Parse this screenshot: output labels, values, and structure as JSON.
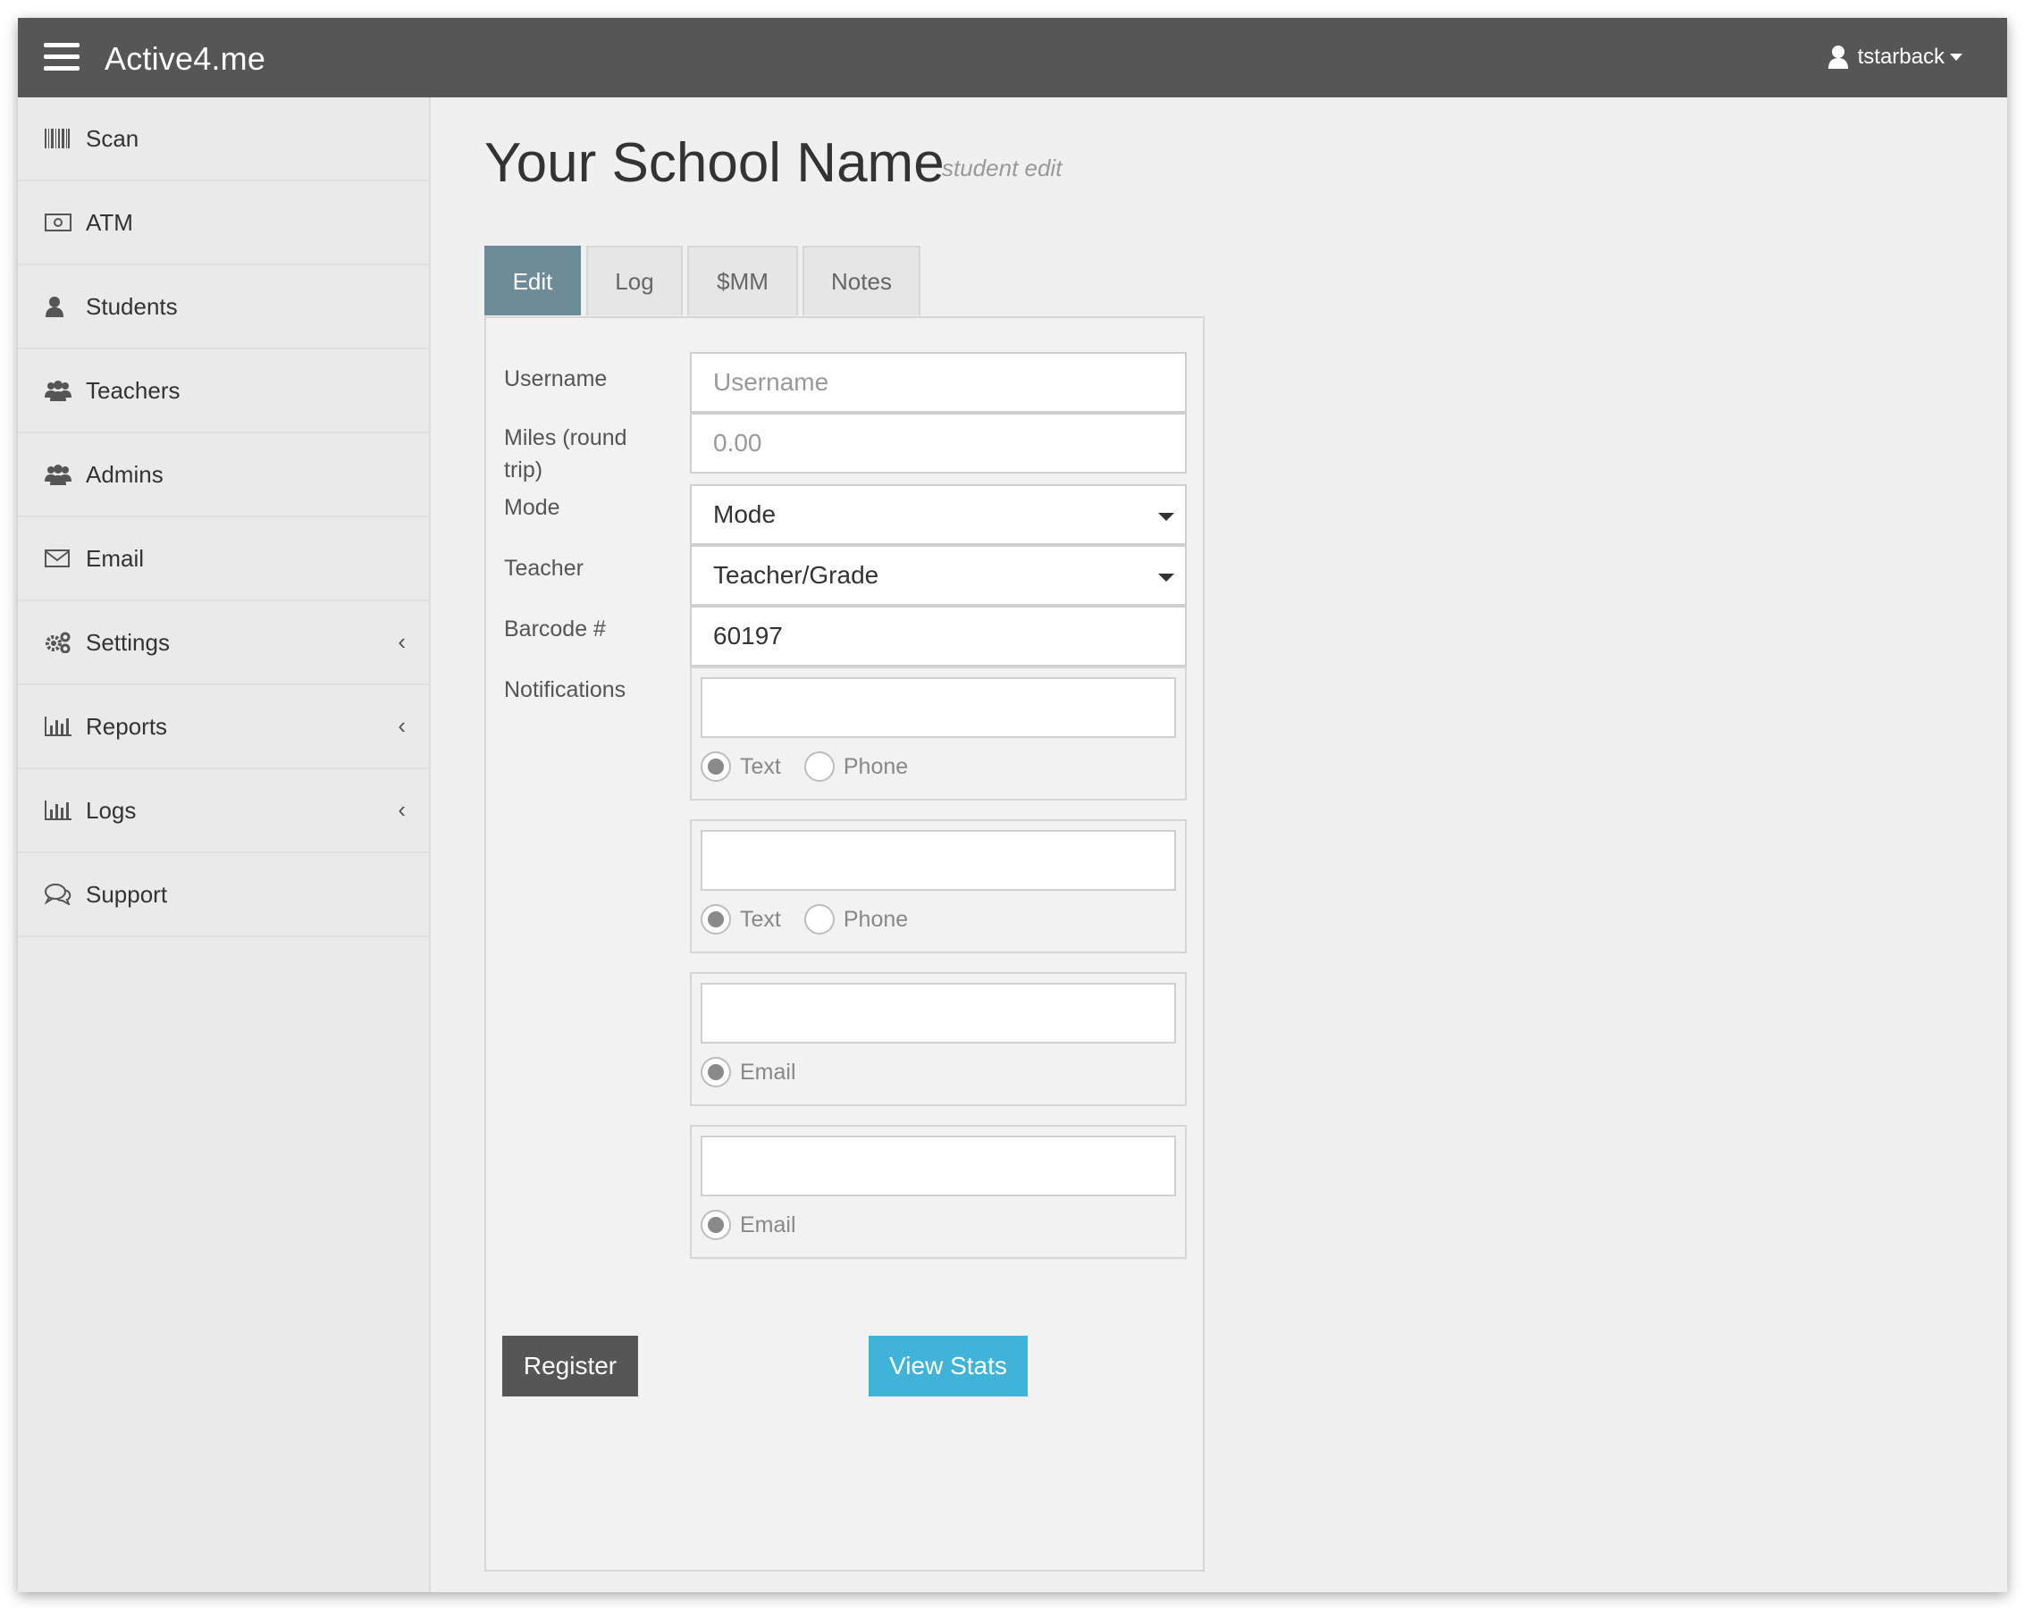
{
  "navbar": {
    "brand": "Active4.me",
    "user": "tstarback"
  },
  "sidebar": {
    "items": [
      {
        "label": "Scan",
        "icon": "barcode-icon"
      },
      {
        "label": "ATM",
        "icon": "money-icon"
      },
      {
        "label": "Students",
        "icon": "user-icon"
      },
      {
        "label": "Teachers",
        "icon": "users-icon"
      },
      {
        "label": "Admins",
        "icon": "users-icon"
      },
      {
        "label": "Email",
        "icon": "envelope-icon"
      },
      {
        "label": "Settings",
        "icon": "gears-icon",
        "chevron": "‹"
      },
      {
        "label": "Reports",
        "icon": "bar-chart-icon",
        "chevron": "‹"
      },
      {
        "label": "Logs",
        "icon": "bar-chart-icon",
        "chevron": "‹"
      },
      {
        "label": "Support",
        "icon": "comments-icon"
      }
    ]
  },
  "page": {
    "title": "Your School Name",
    "subtitle": "student edit"
  },
  "tabs": [
    {
      "label": "Edit",
      "active": true
    },
    {
      "label": "Log",
      "active": false
    },
    {
      "label": "$MM",
      "active": false
    },
    {
      "label": "Notes",
      "active": false
    }
  ],
  "form": {
    "username": {
      "label": "Username",
      "placeholder": "Username",
      "value": ""
    },
    "miles": {
      "label": "Miles (round trip)",
      "placeholder": "0.00",
      "value": ""
    },
    "mode": {
      "label": "Mode",
      "selected": "Mode"
    },
    "teacher": {
      "label": "Teacher",
      "selected": "Teacher/Grade"
    },
    "barcode": {
      "label": "Barcode #",
      "value": "60197"
    },
    "notifications": {
      "label": "Notifications",
      "options": {
        "text": "Text",
        "phone": "Phone",
        "email": "Email"
      }
    }
  },
  "buttons": {
    "register": "Register",
    "view_stats": "View Stats"
  },
  "colors": {
    "navbar": "#565656",
    "active_tab": "#6e8c98",
    "register_button": "#565656",
    "stats_button": "#3fb3d8"
  }
}
